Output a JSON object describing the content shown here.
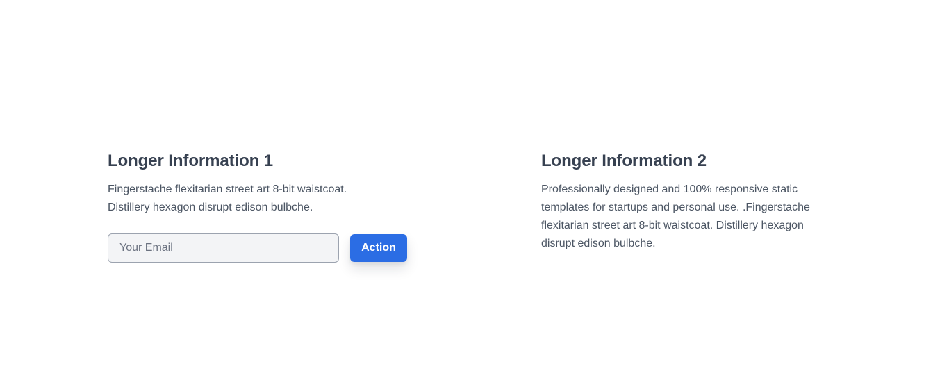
{
  "left": {
    "heading": "Longer Information 1",
    "body": "Fingerstache flexitarian street art 8-bit waistcoat. Distillery hexagon disrupt edison bulbche.",
    "email_placeholder": "Your Email",
    "email_value": "",
    "action_label": "Action"
  },
  "right": {
    "heading": "Longer Information 2",
    "body": "Professionally designed and 100% responsive static templates for startups and personal use. .Fingerstache flexitarian street art 8-bit waistcoat. Distillery hexagon disrupt edison bulbche."
  },
  "colors": {
    "accent": "#2b6de4",
    "heading": "#374151",
    "body": "#4b5563",
    "input_bg": "#f3f4f6",
    "input_border": "#9ca3af",
    "divider": "#e5e7eb"
  }
}
